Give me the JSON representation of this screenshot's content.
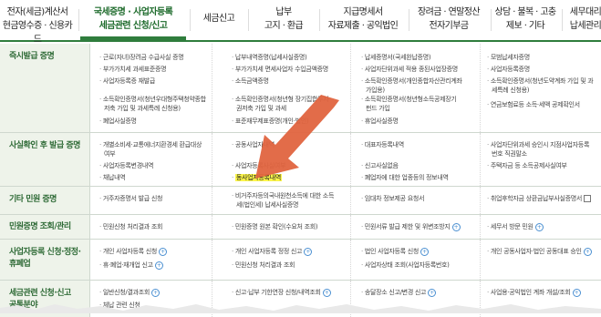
{
  "nav": {
    "items": [
      {
        "label": "전자(세금)계산서\n현금영수증 · 신용카드",
        "active": false
      },
      {
        "label": "국세증명 · 사업자등록\n세금관련 신청/신고",
        "active": true
      },
      {
        "label": "세금신고",
        "active": false
      },
      {
        "label": "납부\n고지 · 환급",
        "active": false
      },
      {
        "label": "지급명세서\n자료제출 · 공익법인",
        "active": false
      },
      {
        "label": "장려금 · 연말정산\n전자기부금",
        "active": false
      },
      {
        "label": "상담 · 불복 · 고충\n제보 · 기타",
        "active": false
      },
      {
        "label": "세무대리\n납세관리",
        "active": false
      }
    ]
  },
  "rows": [
    {
      "title": "즉시발급 증명",
      "cols": [
        [
          "근로(자녀)장려금 수급사실 증명",
          "부가가치세 과세표준증명",
          "사업자등록증 재발급",
          "",
          "소득확인증명서(청년우대형주택청약종합",
          "저축 가입 및 과세특례 신청용)",
          "폐업사실증명"
        ],
        [
          "납부내역증명(납세사실증명)",
          "부가가치세 면세사업자 수입금액증명",
          "소득금액증명",
          "",
          "소득확인증명서(청년형 장기집합투자",
          "권저축 가입 및 과세",
          "표준재무제표증명(개인·법인)"
        ],
        [
          "납세증명서(국세완납증명)",
          "사업자단위과세 적용 종된사업장증명",
          "소득확인증명서(개인종합자산관리계좌",
          "가입용)",
          "소득확인증명서(청년형소득공제장기",
          "펀드 가입",
          "휴업사실증명"
        ],
        [
          "모범납세자증명",
          "사업자등록증명",
          "소득확인증명서(청년도약계좌 가입 및 과",
          "세특례 신청용)",
          "연금보험료등 소득·세액 공제확인서",
          "",
          ""
        ]
      ]
    },
    {
      "title": "사실확인 후 발급 증명",
      "cols": [
        [
          "개별소비세·교통에너지환경세 환급대상",
          "여부",
          "사업자등록변경내역",
          "채납내역"
        ],
        [
          "공동사업자내역",
          "",
          "사업자등록사실여부",
          "동사업자등록내역"
        ],
        [
          "대표자등록내역",
          "",
          "신고사실없음",
          "폐업자에 대한 업종등의 정보내역"
        ],
        [
          "사업자단위과세 승인시 지점사업자등록",
          "번호 직권말소",
          "주택자금 등 소득공제사실여부",
          ""
        ]
      ]
    },
    {
      "title": "기타 민원 증명",
      "cols": [
        [
          "거주자증명서 발급 신청"
        ],
        [
          "비거주자등의국내원천소득에 대한 소득",
          "세(법인세) 납세사실증명"
        ],
        [
          "임대차 정보제공 요청서"
        ],
        [
          "취업후학자금 상환금납부사실증명서"
        ]
      ]
    },
    {
      "title": "민원증명 조회/관리",
      "cols": [
        [
          "민원신청 처리결과 조회"
        ],
        [
          "민원증명 원본 확인(수요처 조회)"
        ],
        [
          "민원서류 발급 제한 및 위변조방지"
        ],
        [
          "세무서 방문 민원"
        ]
      ]
    },
    {
      "title": "사업자등록 신청·정정·\n휴폐업",
      "cols": [
        [
          "개인 사업자등록 신청",
          "휴·폐업·재개업 신고"
        ],
        [
          "개인 사업자등록 정정 신고",
          "민원신청 처리결과 조회"
        ],
        [
          "법인 사업자등록 신청",
          "사업자상태 조회(사업자등록번호)"
        ],
        [
          "개인 공동사업자·법인 공동대표 승인",
          ""
        ]
      ]
    },
    {
      "title": "세금관련 신청·신고\n공통분야",
      "cols": [
        [
          "일반신청/결과조회",
          "체납 관련 신청"
        ],
        [
          "신고·납부 기한연장 신청/내역조회"
        ],
        [
          "송달장소 신고/변경 신고"
        ],
        [
          "사업용·공익법인 계좌 개설/조회"
        ]
      ]
    }
  ],
  "highlight_text": "동사업자등록내역",
  "colors": {
    "accent": "#2f7d3d",
    "arrow": "#e0643f",
    "highlight": "#fbf54a",
    "row_head_bg": "#eef3ea"
  }
}
